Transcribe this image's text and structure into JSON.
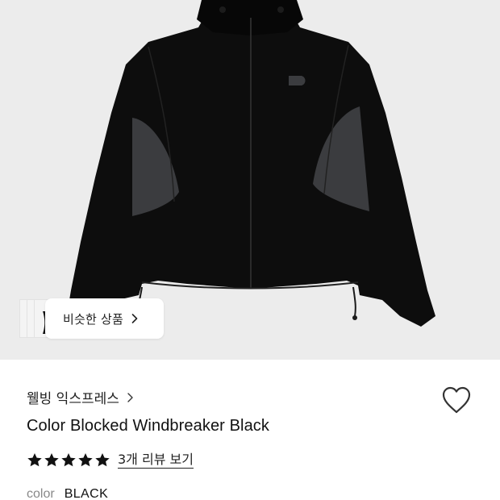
{
  "similar": {
    "label": "비슷한 상품"
  },
  "product": {
    "brand": "웰빙 익스프레스",
    "title": "Color Blocked Windbreaker Black",
    "rating_stars": 5,
    "review_link": "3개 리뷰 보기",
    "color_key": "color",
    "color_value": "BLACK"
  },
  "colors": {
    "hero_bg": "#ececec",
    "jacket": "#0d0d0d",
    "panel": "#3b3c3f",
    "star": "#111111"
  },
  "icons": {
    "similar_chevron": "chevron-right-icon",
    "brand_chevron": "chevron-right-icon",
    "wishlist": "heart-outline-icon",
    "star": "star-filled-icon"
  }
}
